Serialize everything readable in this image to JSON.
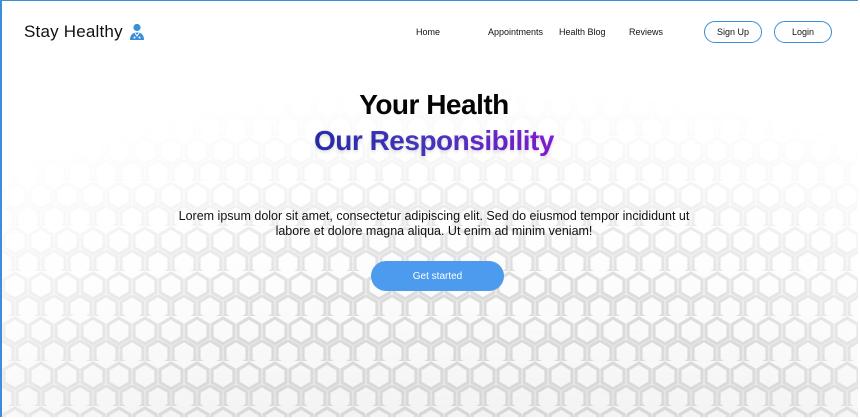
{
  "brand": {
    "name": "Stay Healthy",
    "icon": "doctor-icon"
  },
  "nav": {
    "items": [
      {
        "label": "Home"
      },
      {
        "label": "Appointments"
      },
      {
        "label": "Health Blog"
      },
      {
        "label": "Reviews"
      }
    ],
    "signup_label": "Sign Up",
    "login_label": "Login"
  },
  "hero": {
    "title_line1": "Your Health",
    "title_line2": "Our Responsibility",
    "description": "Lorem ipsum dolor sit amet, consectetur adipiscing elit. Sed do eiusmod tempor incididunt ut labore et dolore magna aliqua. Ut enim ad minim veniam!",
    "cta_label": "Get started"
  },
  "colors": {
    "accent": "#3a8fd8",
    "cta": "#4c9bef",
    "gradient_start": "#2a2fb5",
    "gradient_end": "#8a1ee0"
  }
}
